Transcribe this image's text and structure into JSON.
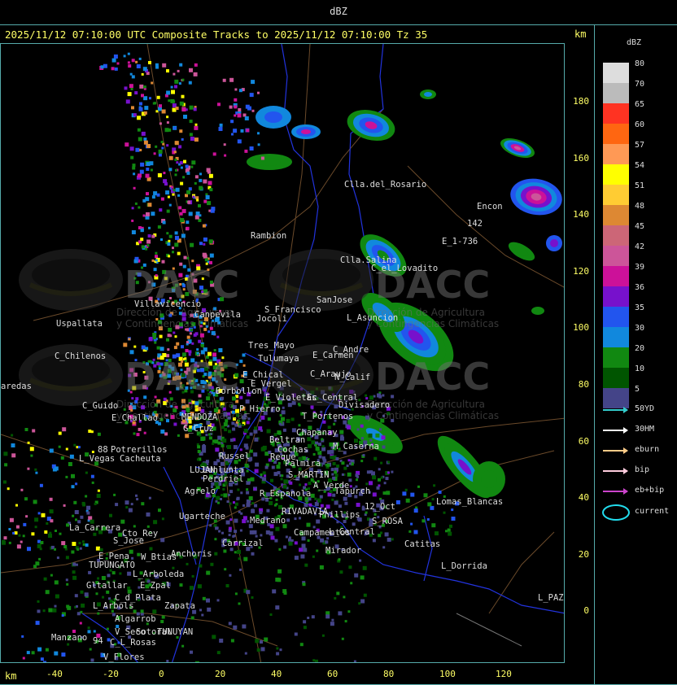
{
  "window_title": "dBZ",
  "subtitle": "2025/11/12 07:10:00 UTC Composite Tracks to 2025/11/12 07:10:00 Tz 35",
  "unit_top": "km",
  "unit_bottom": "km",
  "legend": {
    "title": "dBZ",
    "levels": [
      {
        "label": "80",
        "color": "#dddddd"
      },
      {
        "label": "70",
        "color": "#bbbbbb"
      },
      {
        "label": "65",
        "color": "#ff3322"
      },
      {
        "label": "60",
        "color": "#ff6611"
      },
      {
        "label": "57",
        "color": "#ff9955"
      },
      {
        "label": "54",
        "color": "#ffff00"
      },
      {
        "label": "51",
        "color": "#ffcc33"
      },
      {
        "label": "48",
        "color": "#dd8833"
      },
      {
        "label": "45",
        "color": "#cc6677"
      },
      {
        "label": "42",
        "color": "#cc5599"
      },
      {
        "label": "39",
        "color": "#cc1199"
      },
      {
        "label": "36",
        "color": "#7711cc"
      },
      {
        "label": "35",
        "color": "#2255ee"
      },
      {
        "label": "30",
        "color": "#1188dd"
      },
      {
        "label": "20",
        "color": "#118811"
      },
      {
        "label": "10",
        "color": "#005500"
      },
      {
        "label": "5",
        "color": "#444488"
      }
    ],
    "tracks": [
      {
        "label": "50YD",
        "color": "#33cccc"
      },
      {
        "label": "30HM",
        "color": "#ffffff"
      },
      {
        "label": "eburn",
        "color": "#ffcc88"
      },
      {
        "label": "bip",
        "color": "#ffccdd"
      },
      {
        "label": "eb+bip",
        "color": "#cc44cc"
      }
    ],
    "current_label": "current",
    "current_color": "#22ddee"
  },
  "axes": {
    "y_ticks": [
      "180",
      "160",
      "140",
      "120",
      "100",
      "80",
      "60",
      "40",
      "20",
      "0"
    ],
    "x_ticks": [
      "-40",
      "-20",
      "0",
      "20",
      "40",
      "60",
      "80",
      "100",
      "120"
    ]
  },
  "watermark": {
    "brand": "DACC",
    "line1": "Dirección de Agricultura",
    "line2": "y Contingencias Climáticas"
  },
  "places": [
    {
      "name": "Clla.del_Rosario"
    },
    {
      "name": "Encon"
    },
    {
      "name": "142"
    },
    {
      "name": "E_1-736"
    },
    {
      "name": "Rambion"
    },
    {
      "name": "Clla.Salina"
    },
    {
      "name": "C_el_Lovadito"
    },
    {
      "name": "Villavicencio"
    },
    {
      "name": "Canpevila"
    },
    {
      "name": "S_Francisco"
    },
    {
      "name": "Jocoli"
    },
    {
      "name": "SanJose"
    },
    {
      "name": "L_Asuncion"
    },
    {
      "name": "Uspallata"
    },
    {
      "name": "Tres_Mayo"
    },
    {
      "name": "C_Andre"
    },
    {
      "name": "C_Chilenos"
    },
    {
      "name": "Tulumaya"
    },
    {
      "name": "E_Carmen"
    },
    {
      "name": "E_Chical"
    },
    {
      "name": "C_Araujo"
    },
    {
      "name": "N_Calif"
    },
    {
      "name": "E_Vergel"
    },
    {
      "name": "aredas"
    },
    {
      "name": "Borbollon"
    },
    {
      "name": "E_Violetas"
    },
    {
      "name": "Ec_Central"
    },
    {
      "name": "Divisadero"
    },
    {
      "name": "C_Guido"
    },
    {
      "name": "P_Hierro"
    },
    {
      "name": "E_Challao"
    },
    {
      "name": "MENDOZA"
    },
    {
      "name": "T_Portenos"
    },
    {
      "name": "G_Cruz"
    },
    {
      "name": "Chapanay"
    },
    {
      "name": "Beltran"
    },
    {
      "name": "M_Caserna"
    },
    {
      "name": "88"
    },
    {
      "name": "Potrerillos"
    },
    {
      "name": "Cochas"
    },
    {
      "name": "L_Vegas"
    },
    {
      "name": "Cacheuta"
    },
    {
      "name": "Russel"
    },
    {
      "name": "Reque"
    },
    {
      "name": "Palmira"
    },
    {
      "name": "LUJAN"
    },
    {
      "name": "Lunlunta"
    },
    {
      "name": "S_MARTIN"
    },
    {
      "name": "Perdriel"
    },
    {
      "name": "A_Verde"
    },
    {
      "name": "Agrelo"
    },
    {
      "name": "R_Espanola"
    },
    {
      "name": "Tapurch"
    },
    {
      "name": "12_Oct"
    },
    {
      "name": "Ugarteche"
    },
    {
      "name": "RIVADAVIA"
    },
    {
      "name": "Phillips"
    },
    {
      "name": "Lomas_Blancas"
    },
    {
      "name": "Medrano"
    },
    {
      "name": "S_ROSA"
    },
    {
      "name": "La_Carrera"
    },
    {
      "name": "Cto_Rey"
    },
    {
      "name": "S_Jose"
    },
    {
      "name": "Carrizal"
    },
    {
      "name": "Campamentos"
    },
    {
      "name": "L_Central"
    },
    {
      "name": "Catitas"
    },
    {
      "name": "E_Pena"
    },
    {
      "name": "W_Btias"
    },
    {
      "name": "Anchoris"
    },
    {
      "name": "Mirador"
    },
    {
      "name": "TUPUNGATO"
    },
    {
      "name": "L_Dorrida"
    },
    {
      "name": "L_Arboleda"
    },
    {
      "name": "Gltallar"
    },
    {
      "name": "E_Zpal"
    },
    {
      "name": "C_d_Plata"
    },
    {
      "name": "L_Arbols"
    },
    {
      "name": "Zapata"
    },
    {
      "name": "L_PAZ"
    },
    {
      "name": "Algarrob"
    },
    {
      "name": "V_Seco"
    },
    {
      "name": "Sotoral"
    },
    {
      "name": "TUNUYAN"
    },
    {
      "name": "Manzano"
    },
    {
      "name": "94"
    },
    {
      "name": "C_L_Rosas"
    },
    {
      "name": "V_Flores"
    }
  ]
}
